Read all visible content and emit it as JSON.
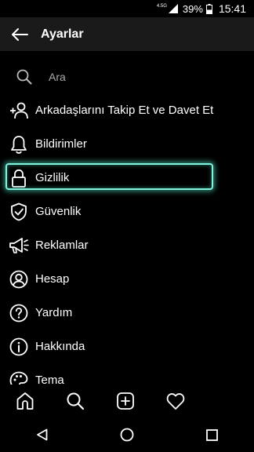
{
  "status_bar": {
    "network": "4.5G",
    "battery_percent": "39%",
    "time": "15:41",
    "icons": [
      "signal-icon",
      "battery-icon"
    ]
  },
  "header": {
    "title": "Ayarlar",
    "back_icon": "arrow-left-icon"
  },
  "search": {
    "placeholder": "Ara",
    "icon": "search-icon"
  },
  "menu": {
    "items": [
      {
        "label": "Arkadaşlarını Takip Et ve Davet Et",
        "icon": "add-person-icon"
      },
      {
        "label": "Bildirimler",
        "icon": "bell-icon"
      },
      {
        "label": "Gizlilik",
        "icon": "lock-icon",
        "selected": true
      },
      {
        "label": "Güvenlik",
        "icon": "shield-check-icon"
      },
      {
        "label": "Reklamlar",
        "icon": "megaphone-icon"
      },
      {
        "label": "Hesap",
        "icon": "account-icon"
      },
      {
        "label": "Yardım",
        "icon": "help-icon"
      },
      {
        "label": "Hakkında",
        "icon": "info-icon"
      },
      {
        "label": "Tema",
        "icon": "palette-icon"
      }
    ]
  },
  "bottom_nav": {
    "items": [
      "home-icon",
      "search-icon",
      "add-post-icon",
      "heart-icon"
    ]
  },
  "system_nav": {
    "items": [
      "back-triangle-icon",
      "home-circle-icon",
      "recents-square-icon"
    ]
  },
  "colors": {
    "background": "#000000",
    "header_background": "#1a1a1a",
    "selection_glow": "#7ff5dd",
    "text": "#ffffff"
  }
}
